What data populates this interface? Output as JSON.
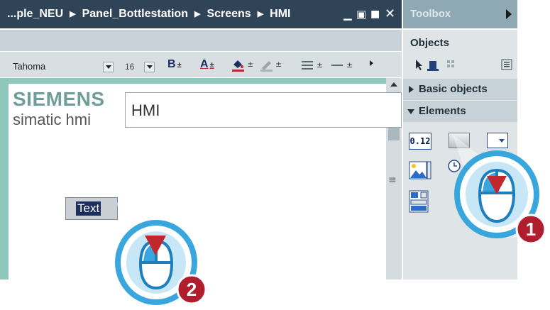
{
  "titlebar": {
    "crumbs": [
      "...ple_NEU",
      "Panel_Bottlestation",
      "Screens",
      "HMI"
    ],
    "separator": "▶",
    "minimize": "▁",
    "restore": "▣",
    "maximize": "■",
    "close": "✕"
  },
  "toolbox": {
    "title": "Toolbox",
    "objects_label": "Objects",
    "basic_objects": "Basic objects",
    "elements": "Elements",
    "io_field_text": "0.12"
  },
  "format_toolbar": {
    "font_name": "Tahoma",
    "font_size": "16",
    "bold": "B",
    "font_color": "A",
    "spinner": "±"
  },
  "canvas": {
    "logo_line1": "SIEMENS",
    "logo_line2": "simatic hmi",
    "screen_name_value": "HMI",
    "text_field_label": "Text",
    "scroll_grip": "≡"
  },
  "callouts": [
    {
      "number": "1",
      "color": "#b01e2d"
    },
    {
      "number": "2",
      "color": "#b01e2d"
    }
  ],
  "colors": {
    "titlebar_bg": "#2f4456",
    "toolbox_header_bg": "#8ea8b4",
    "canvas_border": "#8fc7bd",
    "callout_blue": "#2fa3dc"
  }
}
